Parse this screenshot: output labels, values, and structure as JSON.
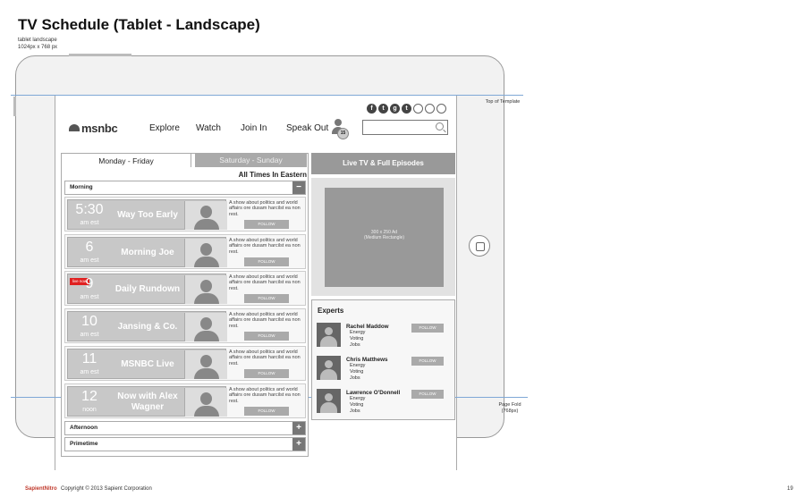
{
  "doc": {
    "title": "TV Schedule (Tablet - Landscape)",
    "subtitle_line1": "tablet landscape",
    "subtitle_line2": "1024px x 768 px",
    "top_of_template": "Top of Template",
    "page_fold_line1": "Page Fold",
    "page_fold_line2": "(768px)",
    "footer_logo": "SapientNitro",
    "copyright": "Copyright © 2013 Sapient Corporation",
    "page_number": "19"
  },
  "social": [
    "f",
    "t",
    "g",
    "t"
  ],
  "header": {
    "logo": "msnbc",
    "nav": [
      "Explore",
      "Watch",
      "Join In",
      "Speak Out"
    ],
    "notification_count": "15"
  },
  "schedule": {
    "tabs": [
      "Monday - Friday",
      "Saturday - Sunday"
    ],
    "timezone": "All Times In Eastern",
    "sections": {
      "morning": "Morning",
      "afternoon": "Afternoon",
      "primetime": "Primetime",
      "collapse": "−",
      "expand": "+"
    },
    "live_now": "live now",
    "follow": "FOLLOW",
    "shows": [
      {
        "time": "5:30",
        "ampm": "am est",
        "name": "Way Too Early",
        "desc": "A show about politics and world affairs ore dusam harcilst ea non rest."
      },
      {
        "time": "6",
        "ampm": "am est",
        "name": "Morning Joe",
        "desc": "A show about politics and world affairs ore dusam harcilst ea non rest."
      },
      {
        "time": "9",
        "ampm": "am est",
        "name": "Daily Rundown",
        "desc": "A show about politics and world affairs ore dusam harcilst ea non rest."
      },
      {
        "time": "10",
        "ampm": "am est",
        "name": "Jansing & Co.",
        "desc": "A show about politics and world affairs ore dusam harcilst ea non rest."
      },
      {
        "time": "11",
        "ampm": "am est",
        "name": "MSNBC Live",
        "desc": "A show about politics and world affairs ore dusam harcilst ea non rest."
      },
      {
        "time": "12",
        "ampm": "noon",
        "name": "Now with Alex Wagner",
        "desc": "A show about politics and world affairs ore dusam harcilst ea non rest."
      }
    ]
  },
  "sidebar": {
    "live_tv": "Live TV & Full Episodes",
    "ad_line1": "300 x 250 Ad",
    "ad_line2": "(Medium Rectangle)",
    "experts_title": "Experts",
    "follow": "FOLLOW",
    "experts": [
      {
        "name": "Rachel Maddow",
        "tags": [
          "Energy",
          "Voting",
          "Jobs"
        ]
      },
      {
        "name": "Chris Matthews",
        "tags": [
          "Energy",
          "Voting",
          "Jobs"
        ]
      },
      {
        "name": "Lawrence O'Donnell",
        "tags": [
          "Energy",
          "Voting",
          "Jobs"
        ]
      }
    ]
  }
}
